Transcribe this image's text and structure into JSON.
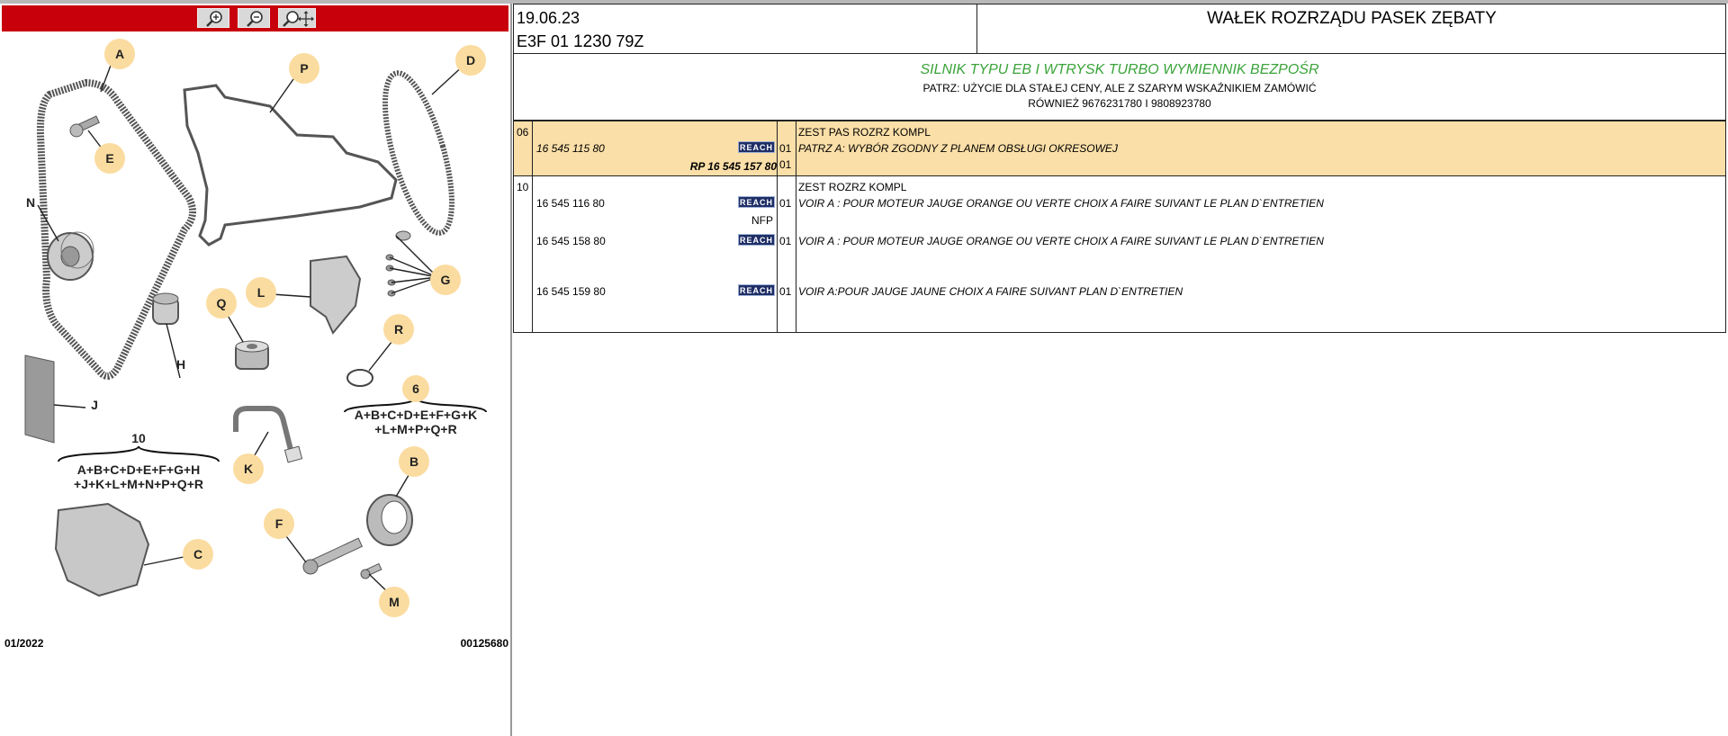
{
  "left": {
    "zoom_buttons": [
      {
        "name": "zoom-in",
        "icon": "magnifier-plus-icon"
      },
      {
        "name": "zoom-out",
        "icon": "magnifier-minus-icon"
      },
      {
        "name": "zoom-pan",
        "icon": "magnifier-move-icon"
      }
    ],
    "diagram_labels": {
      "A": "A",
      "B": "B",
      "C": "C",
      "D": "D",
      "E": "E",
      "F": "F",
      "G": "G",
      "H": "H",
      "J": "J",
      "K": "K",
      "L": "L",
      "M": "M",
      "N": "N",
      "P": "P",
      "Q": "Q",
      "R": "R",
      "six": "6",
      "ten": "10"
    },
    "kit6_line1": "A+B+C+D+E+F+G+K",
    "kit6_line2": "+L+M+P+Q+R",
    "kit10_line1": "A+B+C+D+E+F+G+H",
    "kit10_line2": "+J+K+L+M+N+P+Q+R",
    "footer_date": "01/2022",
    "footer_ref": "00125680"
  },
  "header": {
    "date": "19.06.23",
    "code_prefix": "E3F 01 ",
    "code_bold": "1230",
    "code_suffix": " 79Z",
    "title": "WAŁEK ROZRZĄDU PASEK ZĘBATY"
  },
  "info": {
    "engine": "SILNIK TYPU EB I WTRYSK TURBO WYMIENNIK BEZPOŚR",
    "note1": "PATRZ: UŻYCIE DLA STAŁEJ CENY, ALE Z SZARYM WSKAŹNIKIEM ZAMÓWIĆ",
    "note2": "RÓWNIEŻ 9676231780 I 9808923780"
  },
  "groups": [
    {
      "index": "06",
      "title": "ZEST PAS ROZRZ KOMPL",
      "rows": [
        {
          "part": "16 545 115 80",
          "reach": "REACH",
          "qty": "01",
          "desc": "PATRZ A: WYBÓR ZGODNY Z PLANEM OBSŁUGI OKRESOWEJ"
        },
        {
          "part": "RP 16 545 157 80",
          "reach": "",
          "qty": "01",
          "desc": ""
        }
      ]
    },
    {
      "index": "10",
      "title": "ZEST ROZRZ KOMPL",
      "rows": [
        {
          "part": "16 545 116 80",
          "reach": "REACH",
          "qty": "01",
          "desc": "VOIR A : POUR MOTEUR JAUGE ORANGE OU VERTE CHOIX A FAIRE SUIVANT LE PLAN D`ENTRETIEN",
          "extra": "NFP"
        },
        {
          "part": "16 545 158 80",
          "reach": "REACH",
          "qty": "01",
          "desc": "VOIR A : POUR MOTEUR JAUGE ORANGE OU VERTE CHOIX A FAIRE SUIVANT LE PLAN D`ENTRETIEN"
        },
        {
          "part": "16 545 159 80",
          "reach": "REACH",
          "qty": "01",
          "desc": "VOIR A:POUR JAUGE JAUNE CHOIX A FAIRE SUIVANT PLAN D`ENTRETIEN"
        }
      ]
    }
  ],
  "colors": {
    "toolbar": "#c8000b",
    "highlight": "#fbdfa8",
    "engine_text": "#3aa33a",
    "reach_badge": "#1f2f66",
    "callout": "#fbdca0"
  }
}
